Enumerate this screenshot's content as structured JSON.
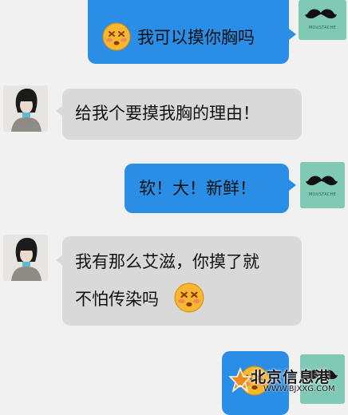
{
  "messages": [
    {
      "sender": "me",
      "text": "我可以摸你胸吗",
      "emoji": "dizzy-face"
    },
    {
      "sender": "other",
      "text": "给我个要摸我胸的理由！"
    },
    {
      "sender": "me",
      "text": "软！大！新鲜！"
    },
    {
      "sender": "other",
      "line1": "我有那么艾滋，你摸了就",
      "line2": "不怕传染吗",
      "emoji": "dizzy-face"
    },
    {
      "sender": "me",
      "emoji": "dizzy-face"
    }
  ],
  "avatar_self": {
    "brand": "MOUSTACHE",
    "icon": "mustache-icon"
  },
  "watermark": {
    "title": "北京信息港",
    "url": "WWW.BJXXG.COM"
  },
  "colors": {
    "outgoing": "#2a8de6",
    "incoming": "#d9d9d9",
    "background": "#f1f1f1",
    "avatar_self": "#7fc9b5"
  }
}
